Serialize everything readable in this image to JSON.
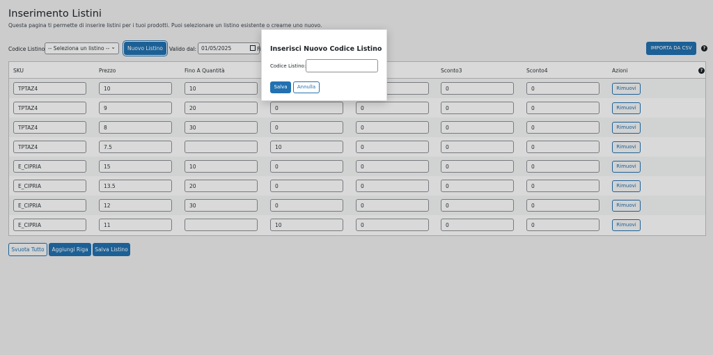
{
  "page": {
    "title": "Inserimento Listini",
    "description": "Questa pagina ti permette di inserire listini per i tuoi prodotti. Puoi selezionare un listino esistente o crearne uno nuovo."
  },
  "toolbar": {
    "codice_label": "Codice Listino:",
    "select_value": "-- Seleziona un listino --",
    "nuovo_label": "Nuovo Listino",
    "valido_label": "Valido dal:",
    "date_value": "01/05/2025",
    "fino_label": "Fi",
    "importa_label": "IMPORTA DA CSV"
  },
  "table": {
    "headers": [
      "SKU",
      "Prezzo",
      "Fino A Quantità",
      "",
      "",
      "Sconto3",
      "Sconto4",
      "Azioni"
    ],
    "rows": [
      [
        "TPTAZ4",
        "10",
        "10",
        "",
        "",
        "0",
        "0"
      ],
      [
        "TPTAZ4",
        "9",
        "20",
        "0",
        "0",
        "0",
        "0"
      ],
      [
        "TPTAZ4",
        "8",
        "30",
        "0",
        "0",
        "0",
        "0"
      ],
      [
        "TPTAZ4",
        "7.5",
        "",
        "10",
        "0",
        "0",
        "0"
      ],
      [
        "E_CIPRIA",
        "15",
        "10",
        "0",
        "0",
        "0",
        "0"
      ],
      [
        "E_CIPRIA",
        "13.5",
        "20",
        "0",
        "0",
        "0",
        "0"
      ],
      [
        "E_CIPRIA",
        "12",
        "30",
        "0",
        "0",
        "0",
        "0"
      ],
      [
        "E_CIPRIA",
        "11",
        "",
        "10",
        "0",
        "0",
        "0"
      ]
    ],
    "remove_label": "Rimuovi"
  },
  "actions": {
    "svuota": "Svuota Tutto",
    "aggiungi": "Aggiungi Riga",
    "salva": "Salva Listino"
  },
  "modal": {
    "title": "Inserisci Nuovo Codice Listino",
    "field_label": "Codice Listino:",
    "field_value": "",
    "save_label": "Salva",
    "cancel_label": "Annulla"
  },
  "colors": {
    "primary": "#2271b1",
    "background": "#f0f0f1"
  }
}
